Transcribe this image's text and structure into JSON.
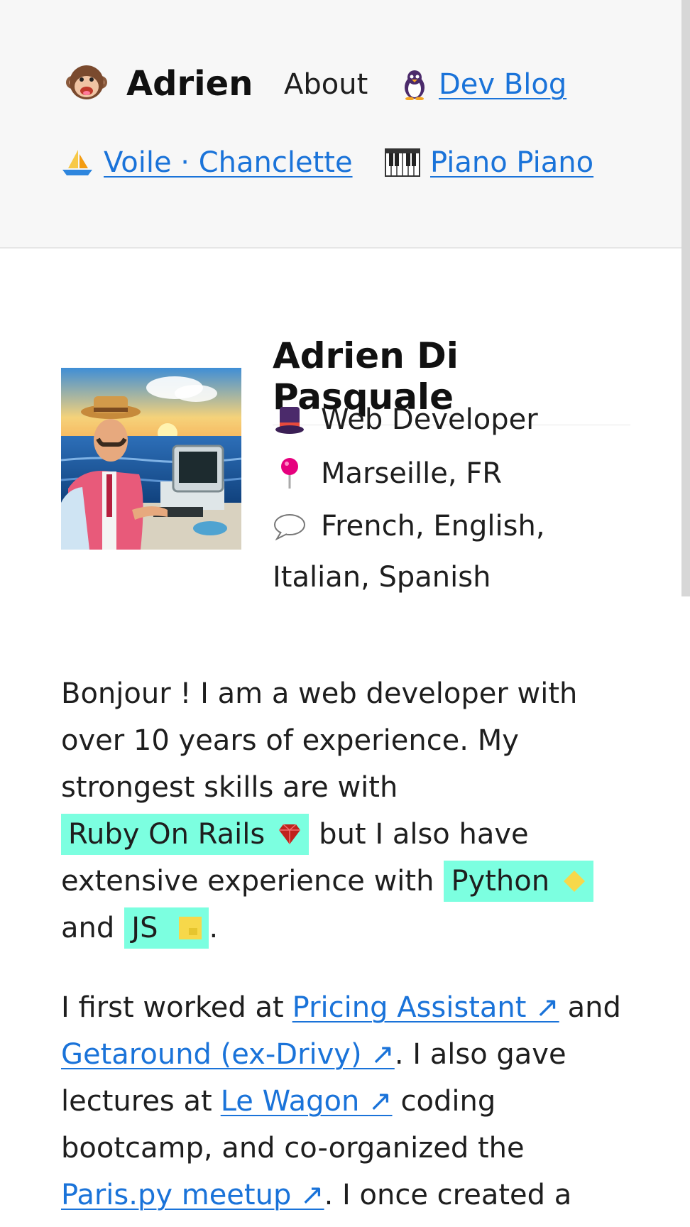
{
  "header": {
    "title": "Adrien",
    "nav": {
      "about": "About",
      "dev_blog": "Dev Blog",
      "voile": "Voile · Chanclette",
      "piano": "Piano Piano"
    }
  },
  "profile": {
    "name": "Adrien Di Pasquale",
    "job": "Web Developer",
    "location": "Marseille, FR",
    "languages_line1": "French, English,",
    "languages_line2": "Italian, Spanish"
  },
  "intro": {
    "l1": "Bonjour ! I am a web developer with",
    "l2": "over 10 years of experience. My",
    "l3": "strongest skills are with",
    "ruby": "Ruby On Rails",
    "l4_after": "but I also have",
    "l5_before": "extensive experience with",
    "python": "Python",
    "l6_before": "and",
    "js": "JS",
    "l6_after": "."
  },
  "work": {
    "l1_before": "I first worked at",
    "pricing": "Pricing Assistant ↗",
    "l1_after": "and",
    "getaround": "Getaround (ex-Drivy) ↗",
    "l2_after": ". I also gave",
    "l3_before": "lectures at",
    "lewagon": "Le Wagon ↗",
    "l3_after": "coding",
    "l4": "bootcamp, and co-organized the",
    "parispy": "Paris.py meetup ↗",
    "l5_after": ". I once created a"
  },
  "colors": {
    "link": "#1a73d9",
    "highlight": "#7cffe0",
    "header_bg": "#f7f7f7"
  },
  "icons": {
    "brand": "monkey-face-icon",
    "dev_blog": "penguin-icon",
    "voile": "sailboat-icon",
    "piano": "piano-keys-icon",
    "job": "top-hat-icon",
    "location": "pushpin-icon",
    "languages": "speech-bubble-icon",
    "ruby": "ruby-gem-icon",
    "python": "python-diamond-icon",
    "js": "js-square-icon"
  }
}
